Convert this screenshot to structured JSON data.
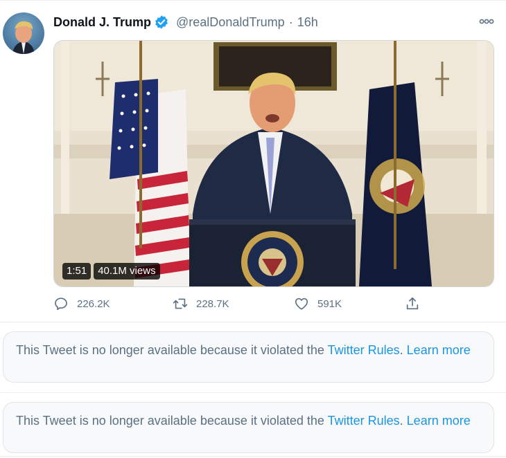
{
  "tweet": {
    "author_name": "Donald J. Trump",
    "handle": "@realDonaldTrump",
    "separator": "·",
    "time": "16h",
    "more_icon": "more-horizontal-icon",
    "verified_icon": "verified-badge-icon",
    "verified_color": "#1da1f2",
    "video": {
      "duration": "1:51",
      "views": "40.1M views"
    },
    "actions": {
      "reply_count": "226.2K",
      "retweet_count": "228.7K",
      "like_count": "591K"
    }
  },
  "notices": [
    {
      "text": "This Tweet is no longer available because it violated the ",
      "link_rules": "Twitter Rules",
      "after_link": ". ",
      "link_learn": "Learn more"
    },
    {
      "text": "This Tweet is no longer available because it violated the ",
      "link_rules": "Twitter Rules",
      "after_link": ". ",
      "link_learn": "Learn more"
    }
  ],
  "colors": {
    "link": "#1b95e0",
    "secondary_text": "#5b7083",
    "notice_bg": "#f7f9fa"
  }
}
